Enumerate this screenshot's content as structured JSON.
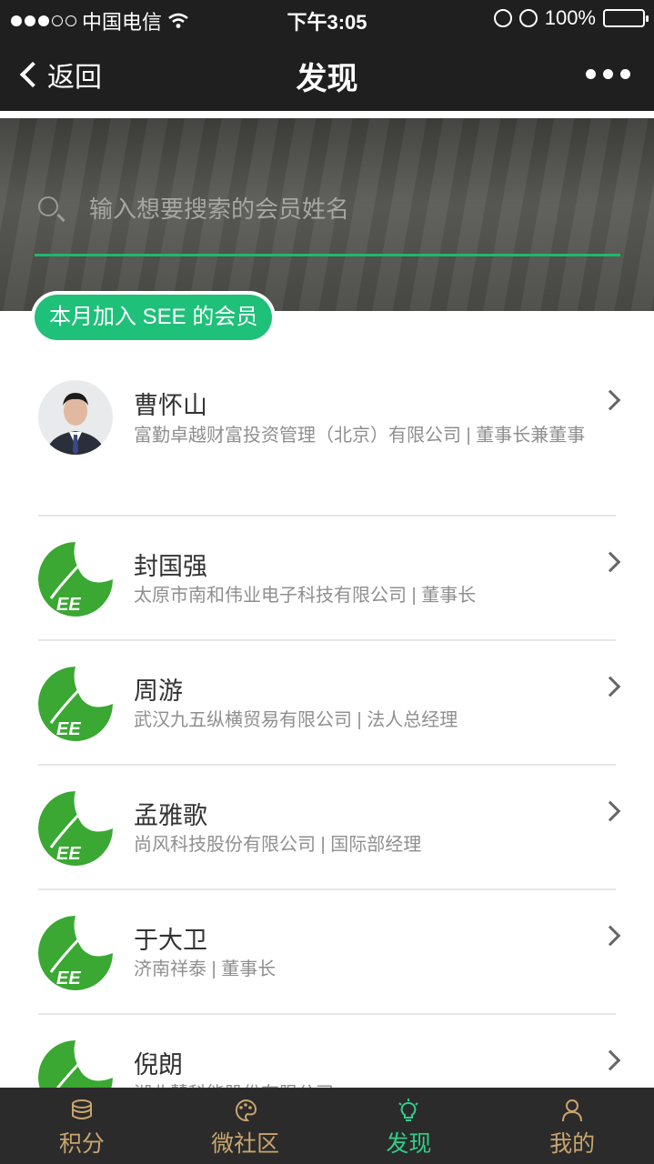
{
  "status_bar": {
    "carrier": "中国电信",
    "time": "下午3:05",
    "battery": "100%"
  },
  "nav": {
    "back_label": "返回",
    "title": "发现"
  },
  "search": {
    "placeholder": "输入想要搜索的会员姓名"
  },
  "section": {
    "label": "本月加入 SEE 的会员"
  },
  "members": [
    {
      "name": "曹怀山",
      "desc": "富勤卓越财富投资管理（北京）有限公司 | 董事长兼董事",
      "avatar": "photo"
    },
    {
      "name": "封国强",
      "desc": "太原市南和伟业电子科技有限公司 | 董事长",
      "avatar": "see-logo"
    },
    {
      "name": "周游",
      "desc": "武汉九五纵横贸易有限公司 | 法人总经理",
      "avatar": "see-logo"
    },
    {
      "name": "孟雅歌",
      "desc": "尚风科技股份有限公司 | 国际部经理",
      "avatar": "see-logo"
    },
    {
      "name": "于大卫",
      "desc": "济南祥泰 | 董事长",
      "avatar": "see-logo"
    },
    {
      "name": "倪朗",
      "desc": "湖北慧科能股份有限公司",
      "avatar": "see-logo"
    }
  ],
  "tabs": [
    {
      "label": "积分",
      "icon": "coins-icon",
      "active": false
    },
    {
      "label": "微社区",
      "icon": "palette-icon",
      "active": false
    },
    {
      "label": "发现",
      "icon": "lightbulb-icon",
      "active": true
    },
    {
      "label": "我的",
      "icon": "person-icon",
      "active": false
    }
  ],
  "colors": {
    "accent": "#1fc07a",
    "tab_inactive": "#c9a46e",
    "tab_active": "#2fcf88",
    "header_bg": "#1f1f1f"
  }
}
